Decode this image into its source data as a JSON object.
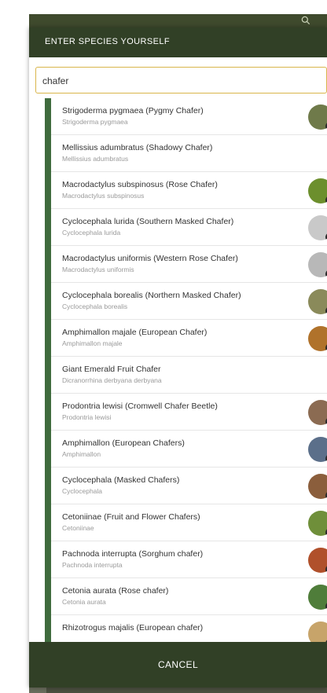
{
  "background_app": {
    "title": "",
    "search_icon": "search-icon"
  },
  "dialog": {
    "title": "ENTER SPECIES YOURSELF",
    "search": {
      "value": "chafer",
      "placeholder": ""
    },
    "results": [
      {
        "title": "Strigoderma pygmaea (Pygmy Chafer)",
        "subtitle": "Strigoderma pygmaea",
        "thumb_color": "#6f7a4a"
      },
      {
        "title": "Mellissius adumbratus (Shadowy Chafer)",
        "subtitle": "Mellissius adumbratus",
        "thumb_color": ""
      },
      {
        "title": "Macrodactylus subspinosus (Rose Chafer)",
        "subtitle": "Macrodactylus subspinosus",
        "thumb_color": "#6c8f2d"
      },
      {
        "title": "Cyclocephala lurida (Southern Masked Chafer)",
        "subtitle": "Cyclocephala lurida",
        "thumb_color": "#c9c9c9"
      },
      {
        "title": "Macrodactylus uniformis (Western Rose Chafer)",
        "subtitle": "Macrodactylus uniformis",
        "thumb_color": "#b8b8b8"
      },
      {
        "title": "Cyclocephala borealis (Northern Masked Chafer)",
        "subtitle": "Cyclocephala borealis",
        "thumb_color": "#8a8a5a"
      },
      {
        "title": "Amphimallon majale (European Chafer)",
        "subtitle": "Amphimallon majale",
        "thumb_color": "#b0722b"
      },
      {
        "title": "Giant Emerald Fruit Chafer",
        "subtitle": "Dicranorrhina derbyana derbyana",
        "thumb_color": ""
      },
      {
        "title": "Prodontria lewisi (Cromwell Chafer Beetle)",
        "subtitle": "Prodontria lewisi",
        "thumb_color": "#8b6b52"
      },
      {
        "title": "Amphimallon (European Chafers)",
        "subtitle": "Amphimallon",
        "thumb_color": "#5b6f8a"
      },
      {
        "title": "Cyclocephala (Masked Chafers)",
        "subtitle": "Cyclocephala",
        "thumb_color": "#8b5e3c"
      },
      {
        "title": "Cetoniinae (Fruit and Flower Chafers)",
        "subtitle": "Cetoniinae",
        "thumb_color": "#6f8f3a"
      },
      {
        "title": "Pachnoda interrupta (Sorghum chafer)",
        "subtitle": "Pachnoda interrupta",
        "thumb_color": "#b0502b"
      },
      {
        "title": "Cetonia aurata (Rose chafer)",
        "subtitle": "Cetonia aurata",
        "thumb_color": "#4f7d3a"
      },
      {
        "title": "Rhizotrogus majalis (European chafer)",
        "subtitle": "",
        "thumb_color": "#c7a46a"
      }
    ],
    "cancel_label": "CANCEL"
  },
  "colors": {
    "header": "#314026",
    "accent": "#d9b54b",
    "rail": "#3f6b3d"
  }
}
